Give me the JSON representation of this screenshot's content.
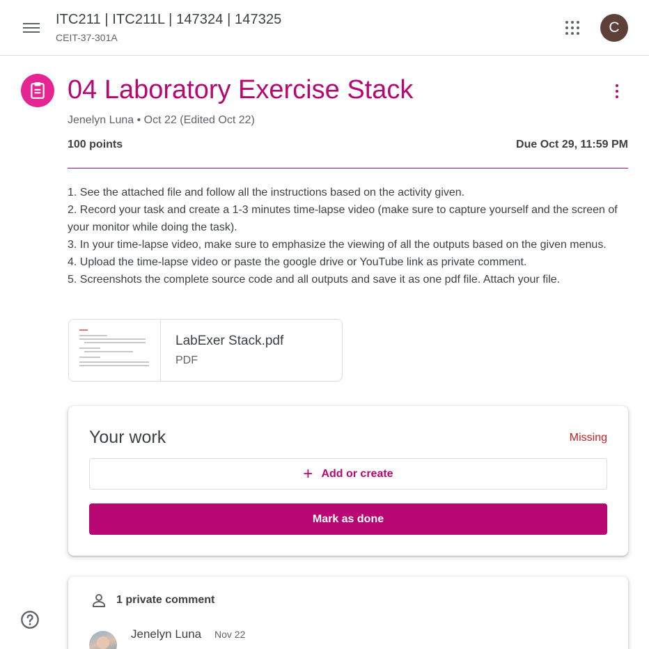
{
  "header": {
    "menu_icon": "hamburger-menu-icon",
    "class_title": "ITC211 | ITC211L | 147324 | 147325",
    "class_section": "CEIT-37-301A",
    "apps_icon": "google-apps-icon",
    "avatar_letter": "C"
  },
  "assignment": {
    "icon": "assignment-clipboard-icon",
    "title": "04 Laboratory Exercise Stack",
    "meta": "Jenelyn Luna • Oct 22 (Edited Oct 22)",
    "points": "100 points",
    "due": "Due Oct 29, 11:59 PM",
    "instructions": [
      "1. See the attached file and follow all the instructions based on the activity given.",
      "2. Record your task and create a 1-3 minutes time-lapse video (make sure to capture yourself and the screen of your monitor while doing the task).",
      "3. In your time-lapse video, make sure to emphasize the viewing of all the outputs based on the given menus.",
      "4. Upload the time-lapse video or paste the google drive or YouTube link as private comment.",
      "5. Screenshots the complete source code and all outputs and save it as one pdf file. Attach your file."
    ],
    "attachment": {
      "name": "LabExer Stack.pdf",
      "type": "PDF"
    }
  },
  "your_work": {
    "title": "Your work",
    "status": "Missing",
    "add_label": "Add or create",
    "done_label": "Mark as done"
  },
  "comments": {
    "label": "1 private comment",
    "author": "Jenelyn Luna",
    "date": "Nov 22"
  },
  "colors": {
    "accent": "#b80672",
    "icon_bg": "#e52592",
    "missing": "#c5221f",
    "avatar_bg": "#5d4037"
  }
}
